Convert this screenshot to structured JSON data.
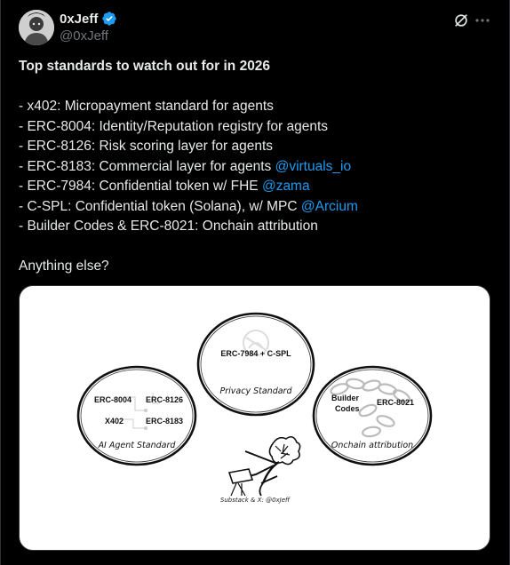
{
  "author": {
    "display_name": "0xJeff",
    "handle": "@0xJeff",
    "verified": true,
    "avatar_icon": "avatar-photo"
  },
  "header_icons": {
    "grok": "grok-icon",
    "more": "more-icon"
  },
  "tweet": {
    "heading": "Top standards to watch out for in 2026",
    "items": [
      {
        "text": "- x402: Micropayment standard for agents",
        "mention": ""
      },
      {
        "text": "- ERC-8004: Identity/Reputation registry for agents",
        "mention": ""
      },
      {
        "text": "- ERC-8126: Risk scoring layer for agents",
        "mention": ""
      },
      {
        "text": "- ERC-8183: Commercial layer for agents ",
        "mention": "@virtuals_io"
      },
      {
        "text": "- ERC-7984: Confidential token w/ FHE ",
        "mention": "@zama"
      },
      {
        "text": "- C-SPL: Confidential token (Solana), w/ MPC ",
        "mention": "@Arcium"
      },
      {
        "text": "- Builder Codes & ERC-8021: Onchain attribution",
        "mention": ""
      }
    ],
    "closing": "Anything else?"
  },
  "image": {
    "privacy": {
      "label": "ERC-7984 + C-SPL",
      "caption": "Privacy Standard"
    },
    "agent": {
      "labels": [
        "ERC-8004",
        "ERC-8126",
        "X402",
        "ERC-8183"
      ],
      "caption": "AI Agent Standard"
    },
    "onchain": {
      "labels": [
        "Builder",
        "Codes",
        "ERC-8021"
      ],
      "caption": "Onchain attribution"
    },
    "credit": "Substack & X: @0xJeff"
  },
  "colors": {
    "background": "#000000",
    "text": "#e7e9ea",
    "muted": "#71767b",
    "link": "#1d9bf0",
    "border": "#2f3336"
  }
}
